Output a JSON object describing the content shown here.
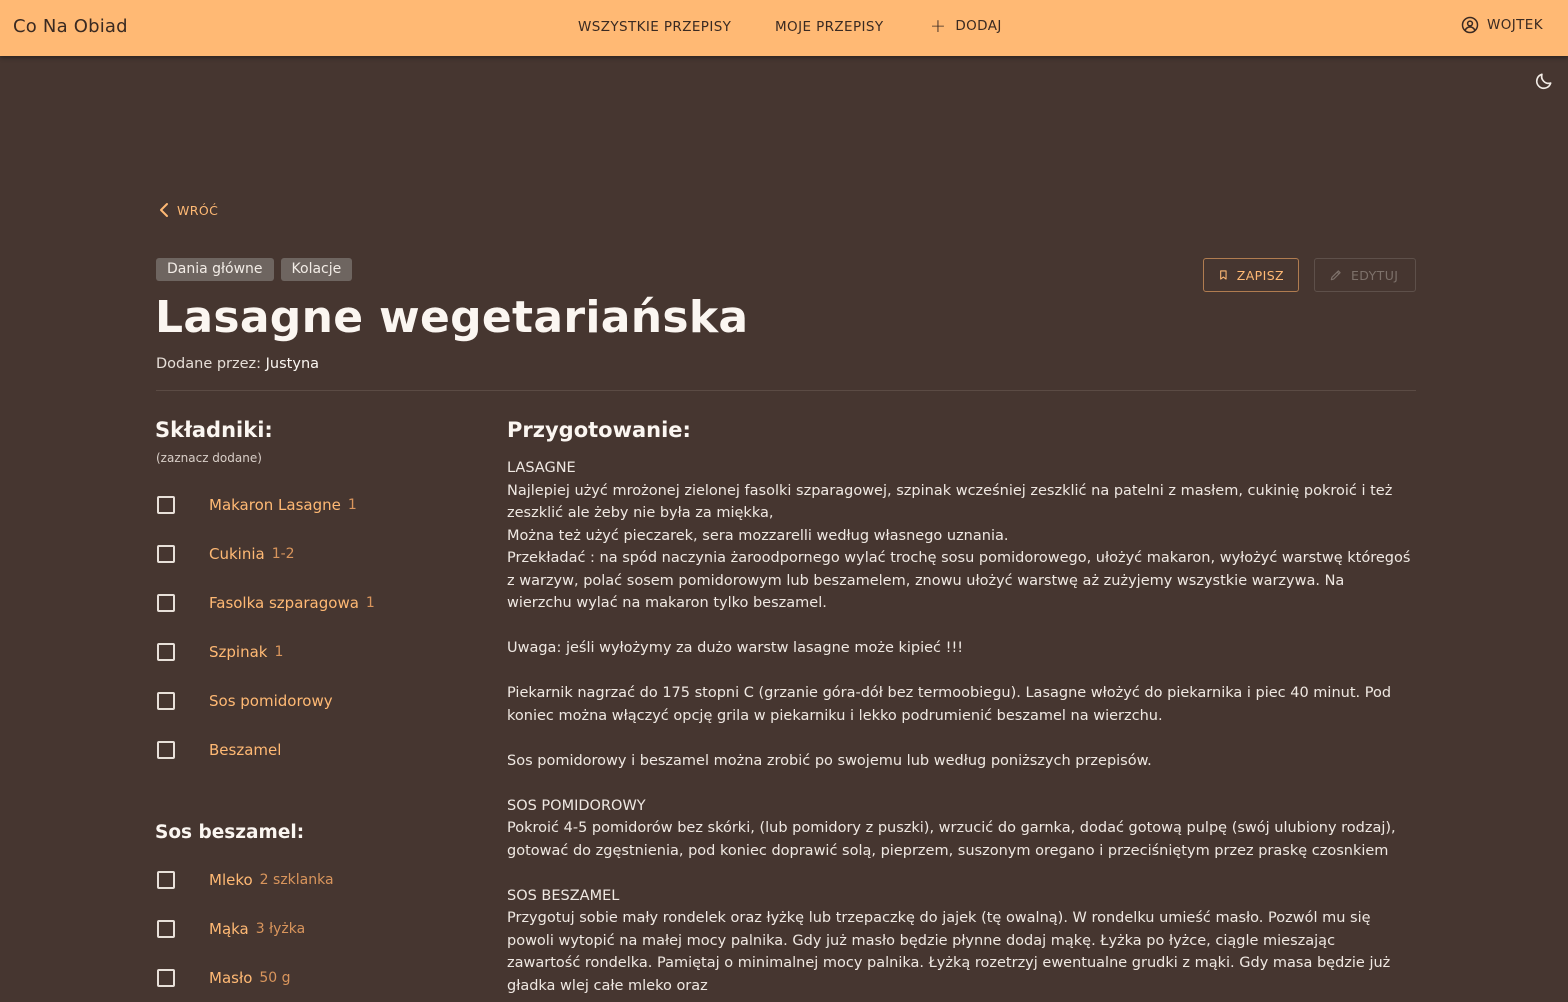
{
  "header": {
    "brand": "Co Na Obiad",
    "nav_all": "WSZYSTKIE PRZEPISY",
    "nav_mine": "MOJE PRZEPISY",
    "nav_add": "DODAJ",
    "user": "WOJTEK"
  },
  "recipe": {
    "back_label": "WRÓĆ",
    "tags": [
      "Dania główne",
      "Kolacje"
    ],
    "save_label": "ZAPISZ",
    "edit_label": "EDYTUJ",
    "title": "Lasagne wegetariańska",
    "author_prefix": "Dodane przez:",
    "author_name": "Justyna"
  },
  "ingredients": {
    "heading": "Składniki:",
    "subheading": "(zaznacz dodane)",
    "items": [
      {
        "name": "Makaron Lasagne",
        "qty": "1"
      },
      {
        "name": "Cukinia",
        "qty": "1-2"
      },
      {
        "name": "Fasolka szparagowa",
        "qty": "1"
      },
      {
        "name": "Szpinak",
        "qty": "1"
      },
      {
        "name": "Sos pomidorowy",
        "qty": ""
      },
      {
        "name": "Beszamel",
        "qty": ""
      }
    ],
    "bechamel_heading": "Sos beszamel:",
    "bechamel_items": [
      {
        "name": "Mleko",
        "qty": "2 szklanka"
      },
      {
        "name": "Mąka",
        "qty": "3 łyżka"
      },
      {
        "name": "Masło",
        "qty": "50 g"
      }
    ]
  },
  "preparation": {
    "heading": "Przygotowanie:",
    "lines": [
      "LASAGNE",
      "Najlepiej użyć mrożonej zielonej fasolki szparagowej, szpinak wcześniej zeszklić na patelni z masłem, cukinię pokroić i też zeszklić ale żeby nie była za miękka,",
      "Można też użyć pieczarek, sera mozzarelli według własnego uznania.",
      "Przekładać : na spód naczynia żaroodpornego wylać trochę sosu pomidorowego, ułożyć makaron, wyłożyć warstwę któregoś z warzyw, polać sosem pomidorowym lub beszamelem, znowu ułożyć warstwę aż zużyjemy wszystkie warzywa. Na wierzchu wylać na makaron tylko beszamel.",
      "",
      "Uwaga: jeśli wyłożymy za dużo warstw lasagne może kipieć !!!",
      "",
      "Piekarnik nagrzać do 175 stopni C (grzanie góra-dół bez termoobiegu). Lasagne włożyć do piekarnika i piec 40 minut. Pod koniec można włączyć opcję grila w piekarniku i lekko podrumienić beszamel na wierzchu.",
      "",
      "Sos pomidorowy i beszamel można zrobić po swojemu lub według poniższych przepisów.",
      "",
      "SOS POMIDOROWY",
      "Pokroić 4-5 pomidorów bez skórki, (lub pomidory z puszki), wrzucić do garnka, dodać gotową pulpę (swój ulubiony rodzaj), gotować do zgęstnienia, pod koniec doprawić solą, pieprzem, suszonym oregano i przeciśniętym przez praskę czosnkiem",
      "",
      "SOS BESZAMEL",
      "Przygotuj sobie mały rondelek oraz łyżkę lub trzepaczkę do jajek (tę owalną). W rondelku umieść masło. Pozwól mu się powoli wytopić na małej mocy palnika. Gdy już masło będzie płynne dodaj mąkę. Łyżka po łyżce, ciągle mieszając zawartość rondelka. Pamiętaj o minimalnej mocy palnika. Łyżką rozetrzyj ewentualne grudki z mąki. Gdy masa będzie już gładka wlej całe mleko oraz"
    ]
  },
  "colors": {
    "accent": "#ffb974",
    "background": "#463630",
    "topbar": "#ffb974"
  }
}
